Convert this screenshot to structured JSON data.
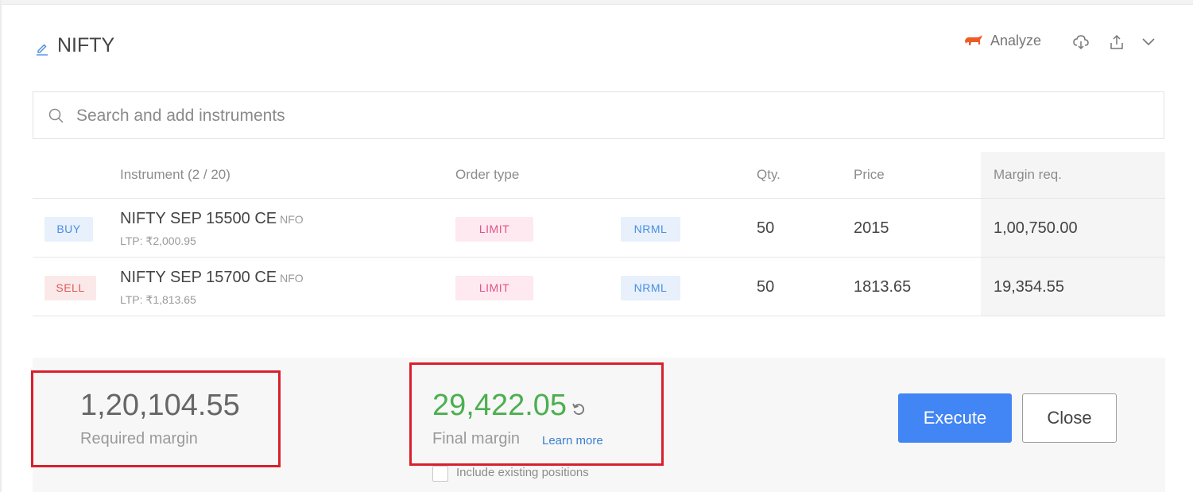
{
  "header": {
    "title": "NIFTY",
    "analyze_label": "Analyze",
    "icons": [
      "edit-icon",
      "bull-icon",
      "download-icon",
      "upload-icon",
      "chevron-down-icon"
    ]
  },
  "search": {
    "placeholder": "Search and add instruments"
  },
  "table": {
    "headers": {
      "instrument": "Instrument (2 / 20)",
      "order_type": "Order type",
      "qty": "Qty.",
      "price": "Price",
      "margin": "Margin req."
    },
    "rows": [
      {
        "side": "BUY",
        "name": "NIFTY SEP 15500 CE",
        "exchange": "NFO",
        "ltp": "LTP: ₹2,000.95",
        "order_type": "LIMIT",
        "product": "NRML",
        "qty": "50",
        "price": "2015",
        "margin": "1,00,750.00"
      },
      {
        "side": "SELL",
        "name": "NIFTY SEP 15700 CE",
        "exchange": "NFO",
        "ltp": "LTP: ₹1,813.65",
        "order_type": "LIMIT",
        "product": "NRML",
        "qty": "50",
        "price": "1813.65",
        "margin": "19,354.55"
      }
    ]
  },
  "footer": {
    "required_margin_value": "1,20,104.55",
    "required_margin_label": "Required margin",
    "final_margin_value": "29,422.05",
    "final_margin_label": "Final margin",
    "learn_more": "Learn more",
    "include_existing": "Include existing positions",
    "execute_label": "Execute",
    "close_label": "Close"
  },
  "colors": {
    "accent": "#4285f4",
    "final_margin": "#4caf50",
    "required_margin": "#666666",
    "highlight_box": "#d9202c",
    "analyze_icon": "#ef5b25"
  }
}
